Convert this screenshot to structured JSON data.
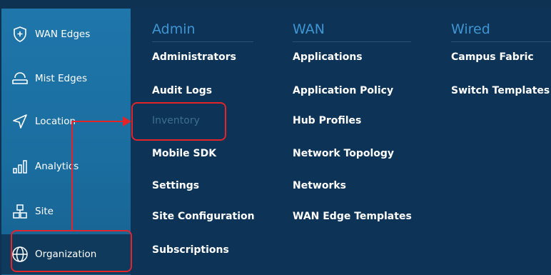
{
  "sidebar": {
    "items": [
      {
        "label": "WAN Edges",
        "icon": "plus-shield-icon"
      },
      {
        "label": "Mist Edges",
        "icon": "cloud-edge-icon"
      },
      {
        "label": "Location",
        "icon": "location-arrow-icon"
      },
      {
        "label": "Analytics",
        "icon": "bar-chart-icon"
      },
      {
        "label": "Site",
        "icon": "site-blocks-icon"
      },
      {
        "label": "Organization",
        "icon": "globe-icon"
      }
    ],
    "active": "Organization"
  },
  "menu": {
    "admin": {
      "heading": "Admin",
      "items": [
        "Administrators",
        "Audit Logs",
        "Inventory",
        "Mobile SDK",
        "Settings",
        "Site Configuration",
        "Subscriptions"
      ]
    },
    "wan": {
      "heading": "WAN",
      "items": [
        "Applications",
        "Application Policy",
        "Hub Profiles",
        "Network Topology",
        "Networks",
        "WAN Edge Templates"
      ]
    },
    "wired": {
      "heading": "Wired",
      "items": [
        "Campus Fabric",
        "Switch Templates"
      ]
    }
  },
  "colors": {
    "highlight": "#e3242b",
    "heading": "#3f95d3",
    "sidebar": "#1f76aa",
    "background": "#0d3456"
  }
}
